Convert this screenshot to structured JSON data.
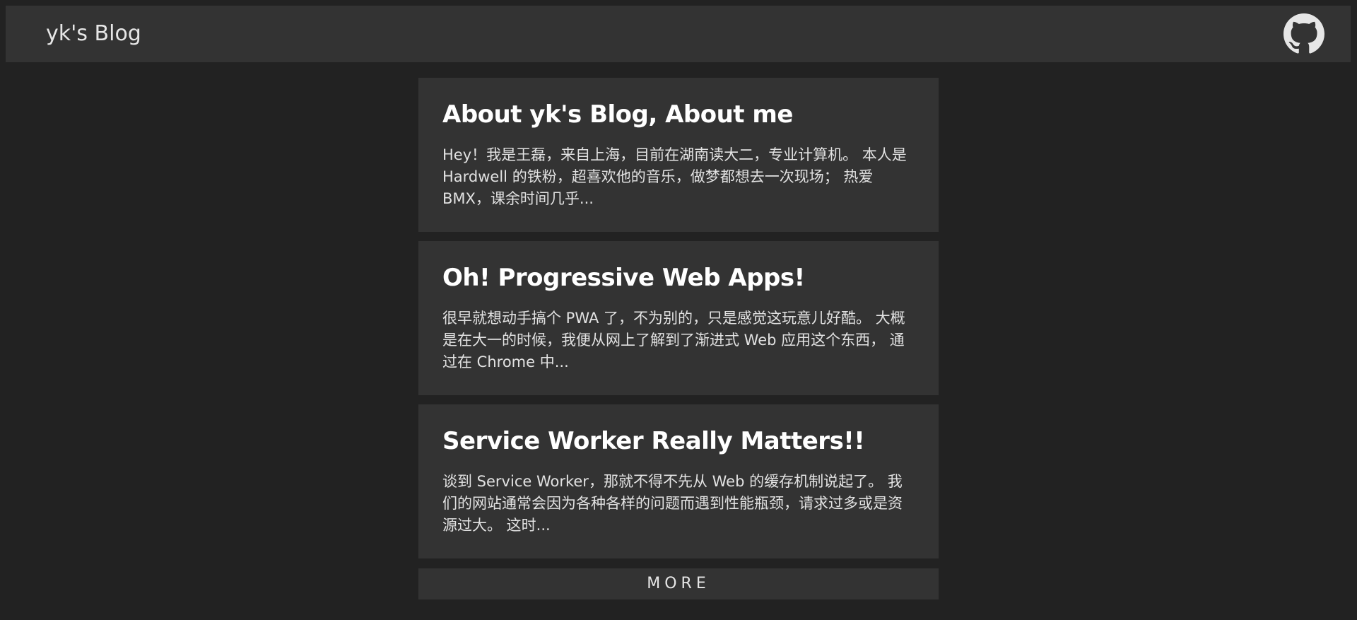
{
  "header": {
    "brand": "yk's Blog",
    "github_icon": "github-icon"
  },
  "posts": [
    {
      "title": "About yk's Blog, About me",
      "excerpt": "Hey！我是王磊，来自上海，目前在湖南读大二，专业计算机。 本人是 Hardwell 的铁粉，超喜欢他的音乐，做梦都想去一次现场； 热爱 BMX，课余时间几乎..."
    },
    {
      "title": "Oh! Progressive Web Apps!",
      "excerpt": "很早就想动手搞个 PWA 了，不为别的，只是感觉这玩意儿好酷。 大概是在大一的时候，我便从网上了解到了渐进式 Web 应用这个东西， 通过在 Chrome 中..."
    },
    {
      "title": "Service Worker Really Matters!!",
      "excerpt": "谈到 Service Worker，那就不得不先从 Web 的缓存机制说起了。 我们的网站通常会因为各种各样的问题而遇到性能瓶颈，请求过多或是资源过大。 这时..."
    }
  ],
  "more_label": "MORE",
  "colors": {
    "page_background": "#222222",
    "card_background": "#333333",
    "text": "#ffffff"
  }
}
